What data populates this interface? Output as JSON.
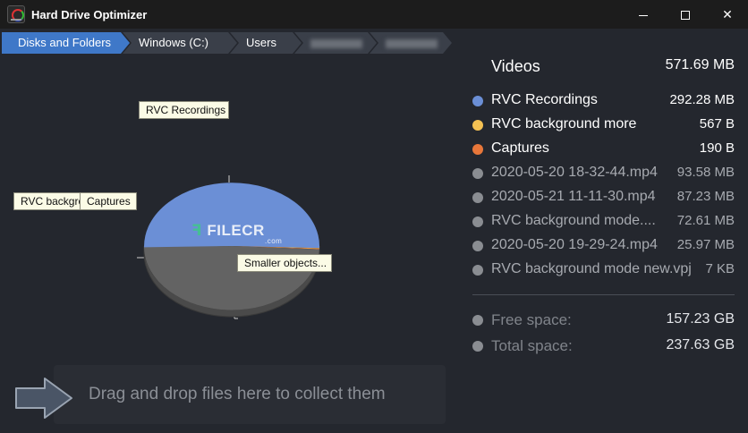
{
  "window": {
    "title": "Hard Drive Optimizer",
    "icon": "hard-drive-optimizer-app-icon",
    "controls": [
      "minimize-icon",
      "maximize-icon",
      "close-icon"
    ]
  },
  "breadcrumb": {
    "items": [
      {
        "label": "Disks and Folders",
        "active": true
      },
      {
        "label": "Windows (C:)",
        "active": false
      },
      {
        "label": "Users",
        "active": false
      }
    ]
  },
  "chart_data": {
    "type": "pie",
    "title": "",
    "unit": "MB",
    "slices": [
      {
        "label": "RVC Recordings",
        "value": 292.28,
        "color": "#6b8fd6"
      },
      {
        "label": "RVC background more",
        "value": 0.000567,
        "color": "#f4c153"
      },
      {
        "label": "Captures",
        "value": 0.00019,
        "color": "#e8773a"
      },
      {
        "label": "Smaller objects...",
        "value": 279.41,
        "color": "#636363"
      }
    ],
    "callouts": {
      "rvc": "RVC Recordings",
      "bg": "RVC background more",
      "cap": "Captures",
      "small": "Smaller objects..."
    }
  },
  "watermark": {
    "text": "FILECR",
    "suffix": ".com"
  },
  "legend": {
    "header": {
      "name": "Videos",
      "size": "571.69 MB"
    },
    "items": [
      {
        "name": "RVC Recordings",
        "size": "292.28 MB",
        "color": "#6b8fd6",
        "style": "bright"
      },
      {
        "name": "RVC background more",
        "size": "567 B",
        "color": "#f4c153",
        "style": "bright"
      },
      {
        "name": "Captures",
        "size": "190 B",
        "color": "#e8773a",
        "style": "bright"
      },
      {
        "name": "2020-05-20 18-32-44.mp4",
        "size": "93.58 MB",
        "color": "#8a8d92",
        "style": "dim"
      },
      {
        "name": "2020-05-21 11-11-30.mp4",
        "size": "87.23 MB",
        "color": "#8a8d92",
        "style": "dim"
      },
      {
        "name": "RVC background mode....",
        "size": "72.61 MB",
        "color": "#8a8d92",
        "style": "dim"
      },
      {
        "name": "2020-05-20 19-29-24.mp4",
        "size": "25.97 MB",
        "color": "#8a8d92",
        "style": "dim"
      },
      {
        "name": "RVC background mode new.vpj",
        "size": "7 KB",
        "color": "#8a8d92",
        "style": "dim"
      }
    ],
    "space": [
      {
        "name": "Free space:",
        "size": "157.23 GB",
        "color": "#8a8d92"
      },
      {
        "name": "Total space:",
        "size": "237.63 GB",
        "color": "#8a8d92"
      }
    ]
  },
  "dropzone": {
    "text": "Drag and drop files here to collect them",
    "icon": "arrow-right-icon"
  }
}
